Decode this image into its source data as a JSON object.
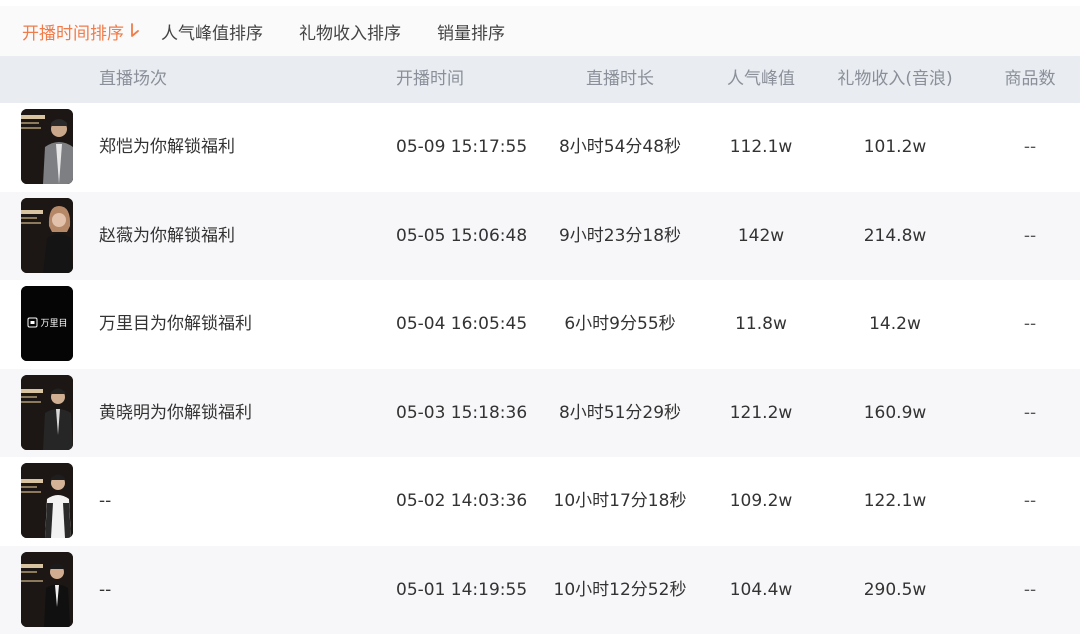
{
  "sort_tabs": [
    {
      "label": "开播时间排序",
      "active": true
    },
    {
      "label": "人气峰值排序",
      "active": false
    },
    {
      "label": "礼物收入排序",
      "active": false
    },
    {
      "label": "销量排序",
      "active": false
    }
  ],
  "colors": {
    "accent": "#f07c4a",
    "header_bg": "#e9ecf1",
    "header_text": "#8a8f99",
    "row_alt_bg": "#f7f7f9"
  },
  "table": {
    "headers": [
      "直播场次",
      "开播时间",
      "直播时长",
      "人气峰值",
      "礼物收入(音浪)",
      "商品数"
    ],
    "rows": [
      {
        "thumb": "host-man-grey-suit",
        "name": "郑恺为你解锁福利",
        "start": "05-09 15:17:55",
        "duration": "8小时54分48秒",
        "peak": "112.1w",
        "gift": "101.2w",
        "goods": "--"
      },
      {
        "thumb": "host-woman-dark",
        "name": "赵薇为你解锁福利",
        "start": "05-05 15:06:48",
        "duration": "9小时23分18秒",
        "peak": "142w",
        "gift": "214.8w",
        "goods": "--"
      },
      {
        "thumb": "brand-logo",
        "thumb_text": "万里目",
        "name": "万里目为你解锁福利",
        "start": "05-04 16:05:45",
        "duration": "6小时9分55秒",
        "peak": "11.8w",
        "gift": "14.2w",
        "goods": "--"
      },
      {
        "thumb": "host-man-dark-suit",
        "name": "黄晓明为你解锁福利",
        "start": "05-03 15:18:36",
        "duration": "8小时51分29秒",
        "peak": "121.2w",
        "gift": "160.9w",
        "goods": "--"
      },
      {
        "thumb": "host-man-white-shirt",
        "name": "--",
        "start": "05-02 14:03:36",
        "duration": "10小时17分18秒",
        "peak": "109.2w",
        "gift": "122.1w",
        "goods": "--"
      },
      {
        "thumb": "host-man-black-suit",
        "name": "--",
        "start": "05-01 14:19:55",
        "duration": "10小时12分52秒",
        "peak": "104.4w",
        "gift": "290.5w",
        "goods": "--"
      }
    ]
  }
}
